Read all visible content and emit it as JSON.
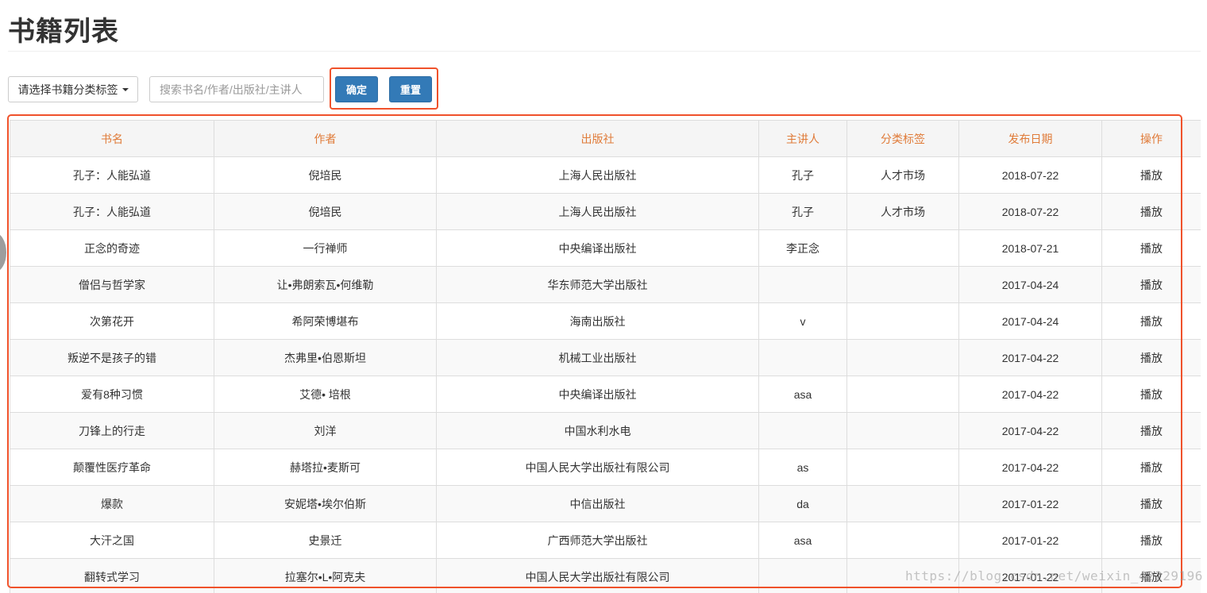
{
  "page": {
    "title": "书籍列表"
  },
  "toolbar": {
    "category_dropdown_label": "请选择书籍分类标签",
    "search_placeholder": "搜索书名/作者/出版社/主讲人",
    "search_value": "",
    "confirm_label": "确定",
    "reset_label": "重置"
  },
  "table": {
    "columns": [
      "书名",
      "作者",
      "出版社",
      "主讲人",
      "分类标签",
      "发布日期",
      "操作"
    ],
    "rows": [
      {
        "title": "孔子：人能弘道",
        "author": "倪培民",
        "publisher": "上海人民出版社",
        "speaker": "孔子",
        "tag": "人才市场",
        "date": "2018-07-22",
        "action": "播放"
      },
      {
        "title": "孔子：人能弘道",
        "author": "倪培民",
        "publisher": "上海人民出版社",
        "speaker": "孔子",
        "tag": "人才市场",
        "date": "2018-07-22",
        "action": "播放"
      },
      {
        "title": "正念的奇迹",
        "author": "一行禅师",
        "publisher": "中央编译出版社",
        "speaker": "李正念",
        "tag": "",
        "date": "2018-07-21",
        "action": "播放"
      },
      {
        "title": "僧侣与哲学家",
        "author": "让•弗朗索瓦•何维勒",
        "publisher": "华东师范大学出版社",
        "speaker": "",
        "tag": "",
        "date": "2017-04-24",
        "action": "播放"
      },
      {
        "title": "次第花开",
        "author": "希阿荣博堪布",
        "publisher": "海南出版社",
        "speaker": "v",
        "tag": "",
        "date": "2017-04-24",
        "action": "播放"
      },
      {
        "title": "叛逆不是孩子的错",
        "author": "杰弗里•伯恩斯坦",
        "publisher": "机械工业出版社",
        "speaker": "",
        "tag": "",
        "date": "2017-04-22",
        "action": "播放"
      },
      {
        "title": "爱有8种习惯",
        "author": "艾德• 培根",
        "publisher": "中央编译出版社",
        "speaker": "asa",
        "tag": "",
        "date": "2017-04-22",
        "action": "播放"
      },
      {
        "title": "刀锋上的行走",
        "author": "刘洋",
        "publisher": "中国水利水电",
        "speaker": "",
        "tag": "",
        "date": "2017-04-22",
        "action": "播放"
      },
      {
        "title": "颠覆性医疗革命",
        "author": "赫塔拉•麦斯可",
        "publisher": "中国人民大学出版社有限公司",
        "speaker": "as",
        "tag": "",
        "date": "2017-04-22",
        "action": "播放"
      },
      {
        "title": "爆款",
        "author": "安妮塔•埃尔伯斯",
        "publisher": "中信出版社",
        "speaker": "da",
        "tag": "",
        "date": "2017-01-22",
        "action": "播放"
      },
      {
        "title": "大汗之国",
        "author": "史景迁",
        "publisher": "广西师范大学出版社",
        "speaker": "asa",
        "tag": "",
        "date": "2017-01-22",
        "action": "播放"
      },
      {
        "title": "翻转式学习",
        "author": "拉塞尔•L•阿克夫",
        "publisher": "中国人民大学出版社有限公司",
        "speaker": "",
        "tag": "",
        "date": "2017-01-22",
        "action": "播放"
      }
    ]
  },
  "watermark": "https://blog.csdn.net/weixin_42229196",
  "colors": {
    "highlight_border": "#f0522b",
    "primary_button": "#337ab7",
    "header_text": "#e07b39"
  }
}
